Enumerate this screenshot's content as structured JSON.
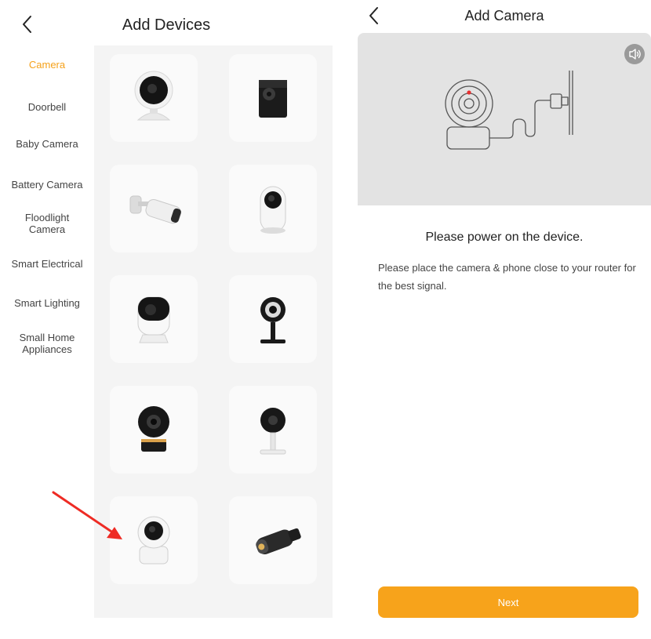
{
  "left_screen": {
    "title": "Add Devices",
    "categories": [
      {
        "label": "Camera",
        "active": true
      },
      {
        "label": "Doorbell"
      },
      {
        "label": "Baby Camera"
      },
      {
        "label": "Battery Camera"
      },
      {
        "label": "Floodlight Camera"
      },
      {
        "label": "Smart Electrical"
      },
      {
        "label": "Smart Lighting"
      },
      {
        "label": "Small Home Appliances"
      }
    ],
    "devices": [
      {
        "icon": "dome-camera-icon"
      },
      {
        "icon": "black-box-camera-icon"
      },
      {
        "icon": "bullet-camera-icon"
      },
      {
        "icon": "white-pill-camera-icon"
      },
      {
        "icon": "white-cube-camera-icon"
      },
      {
        "icon": "black-stand-camera-icon"
      },
      {
        "icon": "black-cube-camera-icon"
      },
      {
        "icon": "white-stand-camera-icon"
      },
      {
        "icon": "pan-tilt-camera-icon"
      },
      {
        "icon": "outdoor-bullet-camera-icon"
      }
    ],
    "highlight_color": "#f5a11a",
    "arrow_color": "#ee2b24"
  },
  "right_screen": {
    "title": "Add Camera",
    "heading": "Please power on the device.",
    "hint": "Please place the camera & phone close to your router for the best signal.",
    "next_label": "Next",
    "button_color": "#f7a31b"
  }
}
